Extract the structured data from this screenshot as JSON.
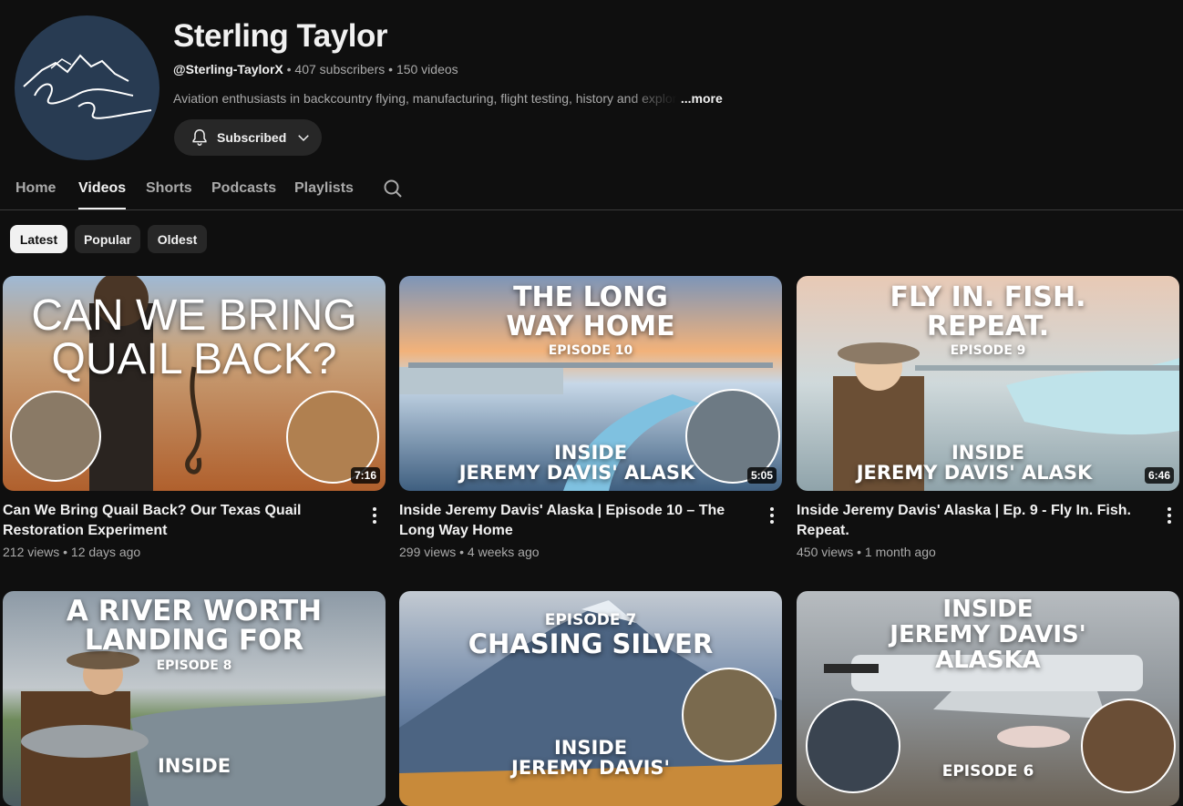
{
  "channel": {
    "name": "Sterling Taylor",
    "handle": "@Sterling-TaylorX",
    "stats": " • 407 subscribers • 150 videos",
    "description": "Aviation enthusiasts in backcountry flying, manufacturing, flight testing, history and exploration",
    "more_label": "...more",
    "subscribe_label": "Subscribed",
    "avatar_text": "Sterling Taylor"
  },
  "tabs": [
    "Home",
    "Videos",
    "Shorts",
    "Podcasts",
    "Playlists"
  ],
  "active_tab": "Videos",
  "chips": [
    "Latest",
    "Popular",
    "Oldest"
  ],
  "active_chip": "Latest",
  "videos": [
    {
      "thumb_line1": "CAN WE BRING",
      "thumb_line2": "QUAIL BACK?",
      "duration": "7:16",
      "title": "Can We Bring Quail Back? Our Texas Quail Restoration Experiment",
      "meta": "212 views • 12 days ago"
    },
    {
      "thumb_line1": "THE LONG",
      "thumb_line2": "WAY HOME",
      "thumb_episode": "EPISODE 10",
      "thumb_bottom1": "INSIDE",
      "thumb_bottom2": "JEREMY DAVIS' ALASK",
      "duration": "5:05",
      "title": "Inside Jeremy Davis' Alaska | Episode 10 – The Long Way Home",
      "meta": "299 views • 4 weeks ago"
    },
    {
      "thumb_line1": "FLY IN. FISH.",
      "thumb_line2": "REPEAT.",
      "thumb_episode": "EPISODE 9",
      "thumb_bottom1": "INSIDE",
      "thumb_bottom2": "JEREMY DAVIS' ALASK",
      "duration": "6:46",
      "title": "Inside Jeremy Davis' Alaska | Ep. 9 - Fly In. Fish. Repeat.",
      "meta": "450 views • 1 month ago"
    },
    {
      "thumb_line1": "A RIVER WORTH",
      "thumb_line2": "LANDING FOR",
      "thumb_episode": "EPISODE 8",
      "thumb_bottom1": "INSIDE"
    },
    {
      "thumb_episode": "EPISODE 7",
      "thumb_line1": "CHASING SILVER",
      "thumb_bottom1": "INSIDE",
      "thumb_bottom2": "JEREMY DAVIS'"
    },
    {
      "thumb_line1": "INSIDE",
      "thumb_line2": "JEREMY DAVIS'",
      "thumb_line3": "ALASKA",
      "thumb_episode": "EPISODE 6"
    }
  ],
  "colors": {
    "background": "#0f0f0f",
    "chip": "#272727",
    "text": "#f1f1f1",
    "secondary": "#aaaaaa"
  },
  "icons": [
    "bell-icon",
    "chevron-down-icon",
    "search-icon",
    "more-vert-icon"
  ]
}
